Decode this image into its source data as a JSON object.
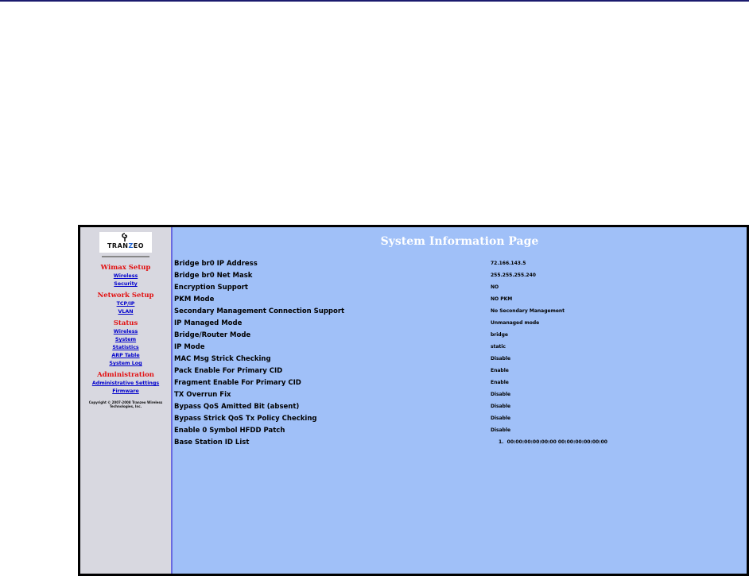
{
  "logo": {
    "text_a": "TRAN",
    "text_b": "Z",
    "text_c": "EO"
  },
  "sidebar": {
    "sections": [
      {
        "title": "Wimax Setup",
        "links": [
          "Wireless",
          "Security"
        ]
      },
      {
        "title": "Network Setup",
        "links": [
          "TCP/IP",
          "VLAN"
        ]
      },
      {
        "title": "Status",
        "links": [
          "Wireless",
          "System",
          "Statistics",
          "ARP Table",
          "System Log"
        ]
      },
      {
        "title": "Administration",
        "links": [
          "Administrative Settings",
          "Firmware"
        ]
      }
    ],
    "copyright": "Copyright © 2007-2008 Tranzeo Wireless Technologies, Inc."
  },
  "page": {
    "title": "System Information Page"
  },
  "rows": [
    {
      "label": "Bridge br0 IP Address",
      "value": "72.166.143.5"
    },
    {
      "label": "Bridge br0 Net Mask",
      "value": "255.255.255.240"
    },
    {
      "label": "Encryption Support",
      "value": "NO"
    },
    {
      "label": "PKM Mode",
      "value": "NO PKM"
    },
    {
      "label": "Secondary Management Connection Support",
      "value": "No Secondary Management"
    },
    {
      "label": "IP Managed Mode",
      "value": "Unmanaged mode"
    },
    {
      "label": "Bridge/Router Mode",
      "value": "bridge"
    },
    {
      "label": "IP Mode",
      "value": "static"
    },
    {
      "label": "MAC Msg Strick Checking",
      "value": "Disable"
    },
    {
      "label": "Pack Enable For Primary CID",
      "value": "Enable"
    },
    {
      "label": "Fragment Enable For Primary CID",
      "value": "Enable"
    },
    {
      "label": "TX Overrun Fix",
      "value": "Disable"
    },
    {
      "label": "Bypass QoS Amitted Bit (absent)",
      "value": "Disable"
    },
    {
      "label": "Bypass Strick QoS Tx Policy Checking",
      "value": "Disable"
    },
    {
      "label": "Enable 0 Symbol HFDD Patch",
      "value": "Disable"
    }
  ],
  "base_station": {
    "label": "Base Station ID List",
    "items": [
      {
        "index": "1.",
        "value": "00:00:00:00:00:00 00:00:00:00:00:00"
      }
    ]
  }
}
